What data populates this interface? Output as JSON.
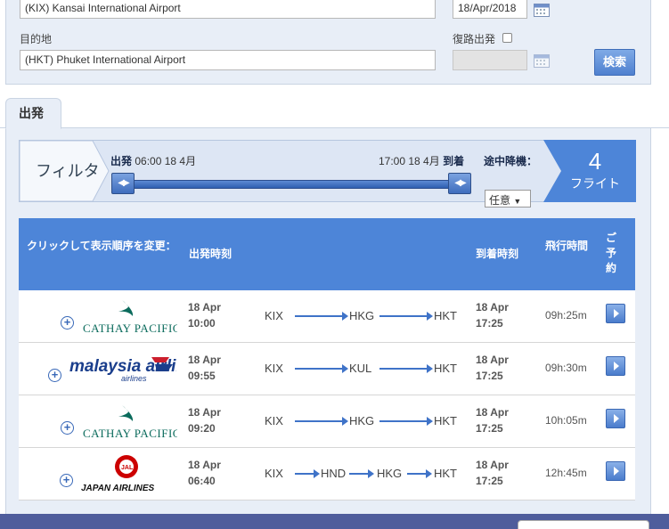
{
  "search": {
    "origin_value": "(KIX) Kansai International Airport",
    "depart_date_value": "18/Apr/2018",
    "destination_label": "目的地",
    "destination_value": "(HKT) Phuket International Airport",
    "return_label": "復路出発",
    "return_date_value": "",
    "search_button": "検索"
  },
  "tabs": [
    {
      "label": "出発"
    }
  ],
  "filter": {
    "title": "フィルタ",
    "departure_prefix": "出発",
    "departure_time": "06:00 18 4月",
    "arrival_time": "17:00 18 4月",
    "arrival_suffix": "到着",
    "stopover_label": "途中降機：",
    "stopover_value": "任意",
    "flight_count": "4",
    "flight_count_unit": "フライト"
  },
  "table": {
    "headers": {
      "sort": "クリックして表示順序を変更：",
      "departure": "出発時刻",
      "arrival": "到着時刻",
      "duration": "飛行時間",
      "book": "ご予約"
    },
    "rows": [
      {
        "airline": "CATHAY PACIFIC",
        "dep_date": "18 Apr",
        "dep_time": "10:00",
        "route": [
          "KIX",
          "HKG",
          "HKT"
        ],
        "arr_date": "18 Apr",
        "arr_time": "17:25",
        "duration": "09h:25m"
      },
      {
        "airline": "malaysia airlines",
        "dep_date": "18 Apr",
        "dep_time": "09:55",
        "route": [
          "KIX",
          "KUL",
          "HKT"
        ],
        "arr_date": "18 Apr",
        "arr_time": "17:25",
        "duration": "09h:30m"
      },
      {
        "airline": "CATHAY PACIFIC",
        "dep_date": "18 Apr",
        "dep_time": "09:20",
        "route": [
          "KIX",
          "HKG",
          "HKT"
        ],
        "arr_date": "18 Apr",
        "arr_time": "17:25",
        "duration": "10h:05m"
      },
      {
        "airline": "JAPAN AIRLINES",
        "dep_date": "18 Apr",
        "dep_time": "06:40",
        "route": [
          "KIX",
          "HND",
          "HKG",
          "HKT"
        ],
        "arr_date": "18 Apr",
        "arr_time": "17:25",
        "duration": "12h:45m"
      }
    ]
  },
  "colors": {
    "header_blue": "#4d85d8",
    "panel_bg": "#e8eef7",
    "cathay_green": "#0b6b5c",
    "jal_red": "#cc0000"
  }
}
